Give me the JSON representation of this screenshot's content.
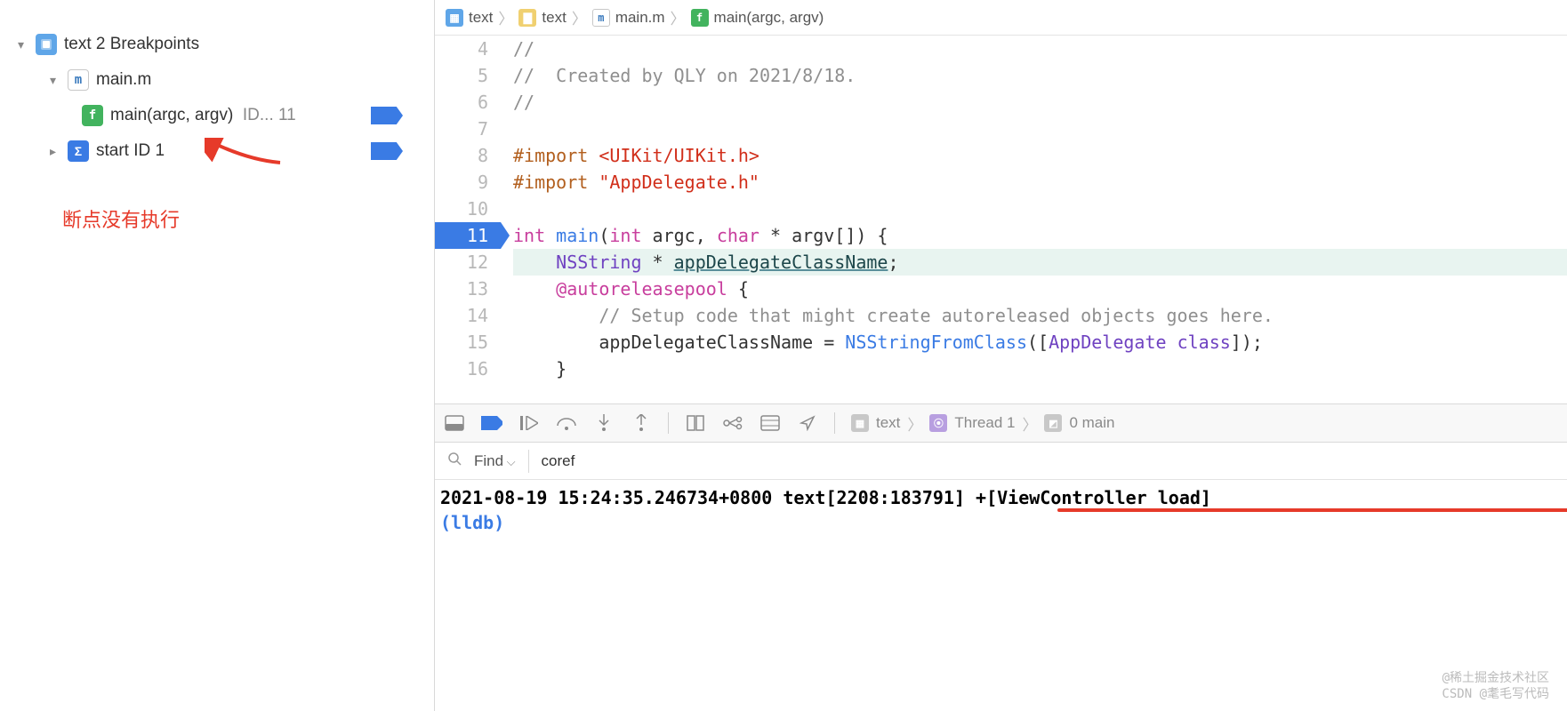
{
  "sidebar": {
    "root": {
      "label": "text",
      "suffix": "2 Breakpoints"
    },
    "file": {
      "label": "main.m"
    },
    "func": {
      "label": "main(argc, argv)",
      "suffix": "ID... 11"
    },
    "sym": {
      "label": "start ID 1"
    },
    "annotation": "断点没有执行"
  },
  "breadcrumb": [
    "text",
    "text",
    "main.m",
    "main(argc, argv)"
  ],
  "code": {
    "lines": [
      {
        "n": 4,
        "t": "comment",
        "txt": "//"
      },
      {
        "n": 5,
        "t": "comment",
        "txt": "//  Created by QLY on 2021/8/18."
      },
      {
        "n": 6,
        "t": "comment",
        "txt": "//"
      },
      {
        "n": 7,
        "t": "blank",
        "txt": ""
      },
      {
        "n": 8,
        "t": "import1",
        "kw": "#import",
        "arg": "<UIKit/UIKit.h>"
      },
      {
        "n": 9,
        "t": "import2",
        "kw": "#import",
        "arg": "\"AppDelegate.h\""
      },
      {
        "n": 10,
        "t": "blank",
        "txt": ""
      },
      {
        "n": 11,
        "t": "mainsig",
        "bp": true
      },
      {
        "n": 12,
        "t": "nsstr",
        "hl": true
      },
      {
        "n": 13,
        "t": "autopool"
      },
      {
        "n": 14,
        "t": "setup"
      },
      {
        "n": 15,
        "t": "assign"
      },
      {
        "n": 16,
        "t": "brace"
      }
    ],
    "tokens": {
      "int": "int",
      "main": "main",
      "char": "char",
      "argc": "int argc",
      "argv": "char * argv[]",
      "nsstring": "NSString",
      "star": " * ",
      "appdel": "appDelegateClassName",
      "semi": ";",
      "arp": "@autoreleasepool",
      "brace_open": " {",
      "setup_comment": "// Setup code that might create autoreleased objects goes here.",
      "assign_lhs": "appDelegateClassName",
      "eq": " = ",
      "nsfc": "NSStringFromClass",
      "op": "([",
      "appdelc": "AppDelegate",
      "sp": " ",
      "classkw": "class",
      "cl": "]);",
      "brace_close": "}"
    }
  },
  "debugbar": {
    "crumbs": [
      "text",
      "Thread 1",
      "0 main"
    ]
  },
  "findbar": {
    "mode": "Find",
    "query": "coref"
  },
  "console": {
    "log": "2021-08-19 15:24:35.246734+0800 text[2208:183791] +[ViewController load]",
    "prompt": "(lldb)"
  },
  "watermark": [
    "@稀土掘金技术社区",
    "CSDN @耄毛写代码"
  ]
}
